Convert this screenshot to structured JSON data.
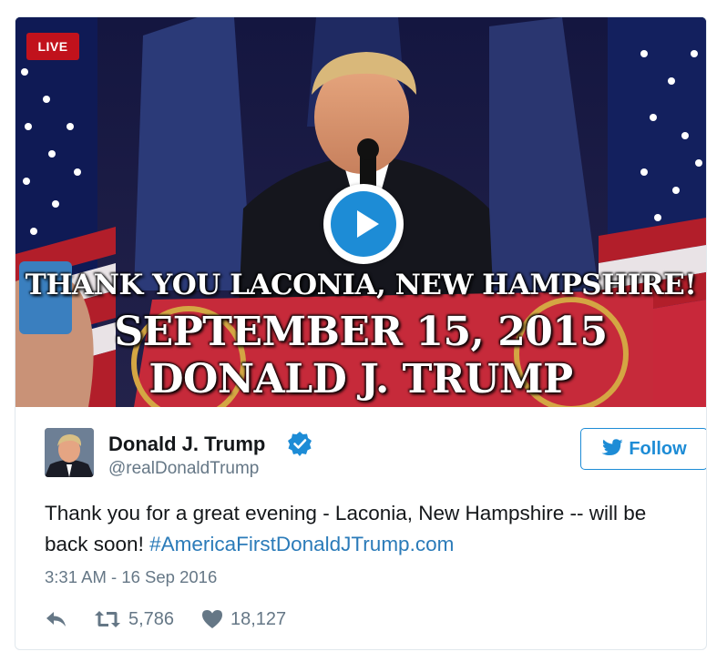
{
  "video": {
    "live_badge": "LIVE",
    "overlay_line1": "THANK YOU LACONIA, NEW HAMPSHIRE!",
    "overlay_line2": "SEPTEMBER 15, 2015",
    "overlay_line3": "DONALD J. TRUMP"
  },
  "author": {
    "name": "Donald J. Trump",
    "handle": "@realDonaldTrump",
    "verified": true
  },
  "follow": {
    "label": "Follow"
  },
  "tweet": {
    "text": "Thank you for a great evening - Laconia, New Hampshire -- will be back soon! ",
    "hashtag": "#AmericaFirstDonaldJTrump.com",
    "timestamp": "3:31 AM - 16 Sep 2016"
  },
  "actions": {
    "retweets": "5,786",
    "likes": "18,127"
  },
  "icons": {
    "live": "live-badge",
    "play": "play-icon",
    "verified": "verified-icon",
    "follow": "twitter-bird-icon",
    "reply": "reply-icon",
    "retweet": "retweet-icon",
    "like": "heart-icon"
  },
  "colors": {
    "accent": "#1d8cd6",
    "live_red": "#c1121c",
    "text": "#14171a",
    "muted": "#657786",
    "hashtag": "#2b7bb9"
  }
}
